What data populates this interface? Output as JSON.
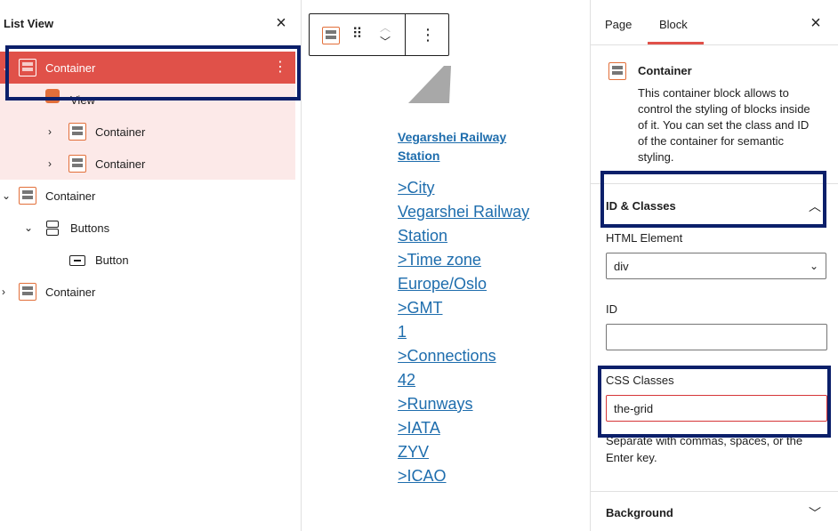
{
  "list_view": {
    "title": "List View",
    "close_glyph": "×",
    "rows": [
      {
        "label": "Container",
        "icon": "container-icon",
        "selected": true
      },
      {
        "label": "View",
        "icon": "view-icon"
      },
      {
        "label": "Container",
        "icon": "container-icon"
      },
      {
        "label": "Container",
        "icon": "container-icon"
      },
      {
        "label": "Container",
        "icon": "container-icon"
      },
      {
        "label": "Buttons",
        "icon": "buttons-icon"
      },
      {
        "label": "Button",
        "icon": "button-icon"
      },
      {
        "label": "Container",
        "icon": "container-icon"
      }
    ]
  },
  "canvas": {
    "station_link": "Vegarshei Railway Station",
    "info_lines": [
      ">City",
      "Vegarshei Railway",
      "Station",
      ">Time zone",
      "Europe/Oslo",
      ">GMT",
      "1",
      ">Connections",
      "42",
      ">Runways",
      ">IATA",
      "ZYV",
      ">ICAO"
    ]
  },
  "sidebar": {
    "tabs": {
      "page": "Page",
      "block": "Block"
    },
    "close_glyph": "×",
    "block_card": {
      "title": "Container",
      "description": "This container block allows to control the styling of blocks inside of it. You can set the class and ID of the container for semantic styling."
    },
    "id_classes_panel": {
      "title": "ID & Classes",
      "html_element_label": "HTML Element",
      "html_element_value": "div",
      "id_label": "ID",
      "id_value": "",
      "css_classes_label": "CSS Classes",
      "css_classes_value": "the-grid",
      "help": "Separate with commas, spaces, or the Enter key."
    },
    "background_panel": {
      "title": "Background"
    }
  },
  "colors": {
    "accent": "#e05149",
    "link": "#1e6dad",
    "highlight_box": "#0b1f6a",
    "block_icon": "#e26f3a"
  }
}
